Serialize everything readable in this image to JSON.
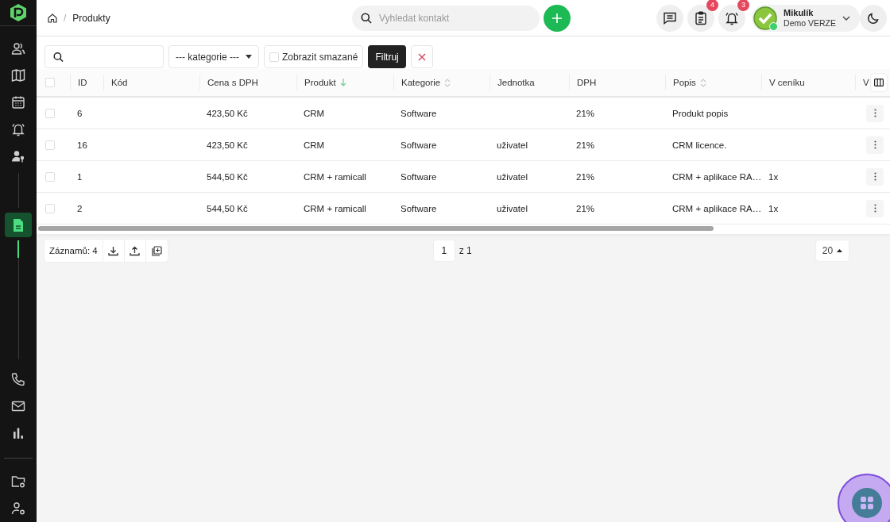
{
  "sidebar": {
    "items": [
      {
        "selected": false
      },
      {
        "selected": false
      },
      {
        "selected": false
      },
      {
        "selected": false
      },
      {
        "selected": false
      },
      {
        "selected": true
      },
      {
        "selected": false
      },
      {
        "selected": false
      },
      {
        "selected": false
      },
      {
        "selected": false
      },
      {
        "selected": false
      }
    ]
  },
  "breadcrumb": {
    "separator": "/",
    "items": [
      "Produkty"
    ]
  },
  "search": {
    "placeholder": "Vyhledat kontakt"
  },
  "header_badges": [
    {
      "has_badge": false
    },
    {
      "has_badge": true,
      "count": "4"
    },
    {
      "has_badge": true,
      "count": "3"
    }
  ],
  "user": {
    "name": "Mikulík",
    "subtitle": "Demo VERZE",
    "online": true
  },
  "filters": {
    "category": "--- kategorie ---",
    "show_deleted": {
      "label": "Zobrazit smazané",
      "checked": false
    },
    "apply": "Filtruj"
  },
  "table": {
    "all_selected": false,
    "columns": [
      {
        "label": "ID",
        "sortable": false,
        "sorted": false
      },
      {
        "label": "Kód",
        "sortable": false,
        "sorted": false
      },
      {
        "label": "Cena s DPH",
        "sortable": false,
        "sorted": false
      },
      {
        "label": "Produkt",
        "sortable": true,
        "sorted": true
      },
      {
        "label": "Kategorie",
        "sortable": true,
        "sorted": false
      },
      {
        "label": "Jednotka",
        "sortable": false,
        "sorted": false
      },
      {
        "label": "DPH",
        "sortable": false,
        "sorted": false
      },
      {
        "label": "Popis",
        "sortable": true,
        "sorted": false
      },
      {
        "label": "V ceníku",
        "sortable": false,
        "sorted": false
      },
      {
        "label": "V",
        "sortable": false,
        "sorted": false
      }
    ],
    "rows": [
      {
        "selected": false,
        "cells": [
          "6",
          "",
          "423,50 Kč",
          "CRM",
          "Software",
          "",
          "21%",
          "Produkt popis",
          "",
          ""
        ]
      },
      {
        "selected": false,
        "cells": [
          "16",
          "",
          "423,50 Kč",
          "CRM",
          "Software",
          "uživatel",
          "21%",
          "CRM licence.",
          "",
          ""
        ]
      },
      {
        "selected": false,
        "cells": [
          "1",
          "",
          "544,50 Kč",
          "CRM + ramicall",
          "Software",
          "uživatel",
          "21%",
          "CRM + aplikace RA…",
          "1x",
          ""
        ]
      },
      {
        "selected": false,
        "cells": [
          "2",
          "",
          "544,50 Kč",
          "CRM + ramicall",
          "Software",
          "uživatel",
          "21%",
          "CRM + aplikace RA…",
          "1x",
          ""
        ]
      }
    ]
  },
  "footer": {
    "records": "Záznamů: 4",
    "page": "1",
    "of": "z 1",
    "page_size": "20"
  }
}
